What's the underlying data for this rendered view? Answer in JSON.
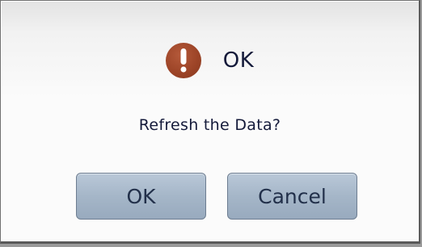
{
  "dialog": {
    "title": "OK",
    "icon": "warning-icon",
    "icon_color": "#9b4326",
    "message": "Refresh the Data?",
    "buttons": {
      "ok_label": "OK",
      "cancel_label": "Cancel"
    }
  }
}
